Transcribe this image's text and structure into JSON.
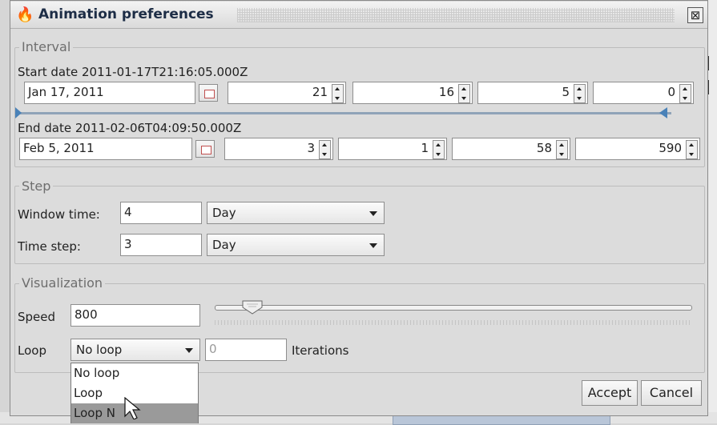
{
  "window": {
    "title": "Animation preferences",
    "close_glyph": "⊠",
    "icon": "app-flame-icon"
  },
  "interval": {
    "legend": "Interval",
    "start_label": "Start date 2011-01-17T21:16:05.000Z",
    "start": {
      "date": "Jan 17, 2011",
      "hour": "21",
      "minute": "16",
      "second": "5",
      "millis": "0"
    },
    "end_label": "End date 2011-02-06T04:09:50.000Z",
    "end": {
      "date": "Feb 5, 2011",
      "hour": "3",
      "minute": "1",
      "second": "58",
      "millis": "590"
    }
  },
  "step": {
    "legend": "Step",
    "window_time_label": "Window time:",
    "window_time_value": "4",
    "window_time_unit": "Day",
    "time_step_label": "Time step:",
    "time_step_value": "3",
    "time_step_unit": "Day"
  },
  "visualization": {
    "legend": "Visualization",
    "speed_label": "Speed",
    "speed_value": "800",
    "speed_slider_fraction": 0.06,
    "loop_label": "Loop",
    "loop_value": "No loop",
    "iterations_value": "0",
    "iterations_label": "Iterations",
    "loop_options": [
      "No loop",
      "Loop",
      "Loop N"
    ]
  },
  "buttons": {
    "accept": "Accept",
    "cancel": "Cancel"
  },
  "colors": {
    "title_text": "#1d2d46",
    "selection": "#9a9a9a",
    "range_marker": "#4a82b8"
  }
}
